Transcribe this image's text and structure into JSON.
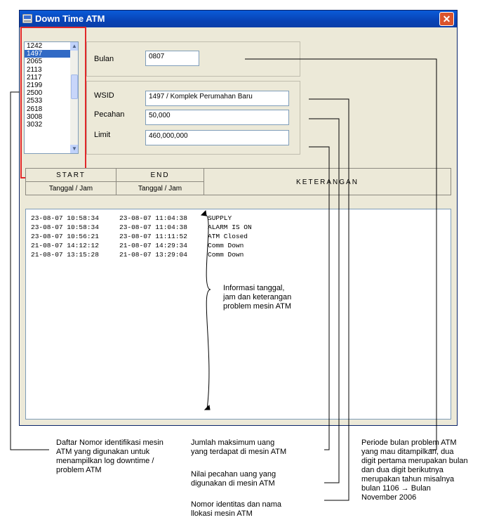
{
  "window": {
    "title": "Down Time ATM",
    "close_glyph": "✕"
  },
  "listbox": {
    "items": [
      "1242",
      "1497",
      "2065",
      "2113",
      "2117",
      "2199",
      "2500",
      "2533",
      "2618",
      "3008",
      "3032"
    ],
    "selected": "1497"
  },
  "bulan": {
    "label": "Bulan",
    "value": "0807"
  },
  "wsid": {
    "label": "WSID",
    "value": "1497 / Komplek Perumahan Baru"
  },
  "pecahan": {
    "label": "Pecahan",
    "value": "50,000"
  },
  "limit": {
    "label": "Limit",
    "value": "460,000,000"
  },
  "table": {
    "start": "START",
    "end": "END",
    "keterangan": "KETERANGAN",
    "sub_start": "Tanggal / Jam",
    "sub_end": "Tanggal / Jam"
  },
  "log_rows": [
    {
      "start": "23-08-07 10:58:34",
      "end": "23-08-07 11:04:38",
      "ket": "SUPPLY"
    },
    {
      "start": "23-08-07 10:58:34",
      "end": "23-08-07 11:04:38",
      "ket": "ALARM IS ON"
    },
    {
      "start": "23-08-07 10:56:21",
      "end": "23-08-07 11:11:52",
      "ket": "ATM Closed"
    },
    {
      "start": "21-08-07 14:12:12",
      "end": "21-08-07 14:29:34",
      "ket": "Comm Down"
    },
    {
      "start": "21-08-07 13:15:28",
      "end": "21-08-07 13:29:04",
      "ket": "Comm Down"
    }
  ],
  "annotations": {
    "info": [
      "Informasi tanggal,",
      "jam dan keterangan",
      "problem mesin ATM"
    ],
    "daftar": [
      "Daftar Nomor identifikasi mesin",
      "ATM yang digunakan untuk",
      "menampilkan log downtime /",
      "problem ATM"
    ],
    "jumlah": [
      "Jumlah maksimum uang",
      "yang terdapat di mesin ATM"
    ],
    "nilai": [
      "Nilai pecahan uang yang",
      "digunakan di mesin ATM"
    ],
    "nomor": [
      "Nomor identitas dan nama",
      "llokasi mesin ATM"
    ],
    "periode": [
      "Periode bulan problem ATM",
      "yang mau ditampilkan,  dua",
      "digit pertama merupakan bulan",
      "dan dua digit berikutnya",
      "merupakan tahun misalnya",
      "bulan 1106 → Bulan",
      "November 2006"
    ]
  },
  "colors": {
    "titlebar": "#0843b5",
    "highlight": "#e1282a",
    "selection": "#316ac5",
    "window_bg": "#ece9d8"
  },
  "icons": {
    "app": "app-icon",
    "close": "close-icon",
    "scroll_up": "scroll-up-icon",
    "scroll_down": "scroll-down-icon"
  }
}
